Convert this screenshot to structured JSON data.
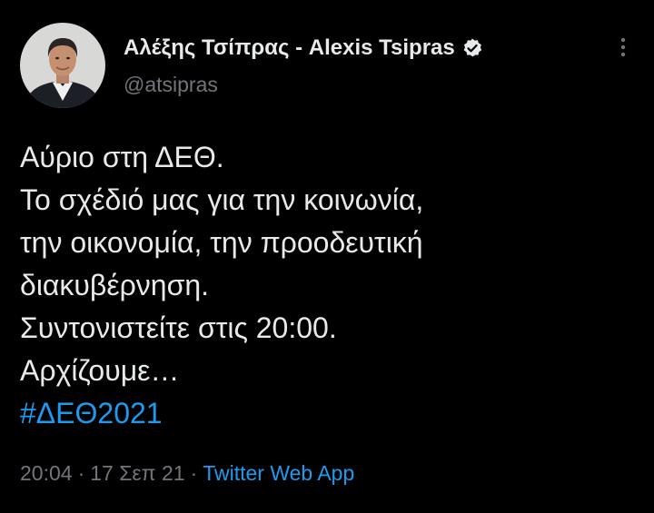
{
  "author": {
    "display_name": "Αλέξης Τσίπρας - Alexis Tsipras",
    "handle": "@atsipras",
    "verified": true,
    "avatar_icon": "profile-photo"
  },
  "tweet": {
    "lines": [
      "Αύριο στη ΔΕΘ.",
      "Το σχέδιό μας για την κοινωνία,",
      "την οικονομία, την προοδευτική",
      "διακυβέρνηση.",
      "Συντονιστείτε στις 20:00.",
      "Αρχίζουμε…"
    ],
    "hashtag": "#ΔΕΘ2021"
  },
  "meta": {
    "time": "20:04",
    "separator": "·",
    "date": "17 Σεπ 21",
    "source": "Twitter Web App"
  },
  "colors": {
    "background": "#000000",
    "text": "#e7e9ea",
    "secondary": "#71767b",
    "link": "#1d9bf0"
  },
  "icons": {
    "verified": "verified-badge-icon",
    "more": "more-options-icon"
  }
}
